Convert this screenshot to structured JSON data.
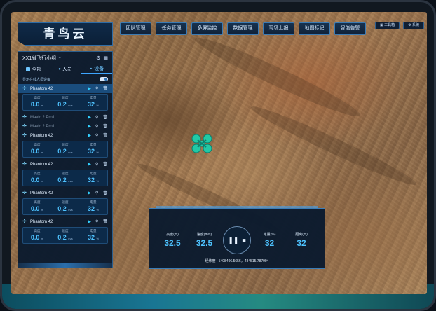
{
  "app": {
    "title": "青鸟云"
  },
  "nav": [
    "团队管理",
    "任务管理",
    "多屏监控",
    "数据管理",
    "现场上报",
    "地图标记",
    "智能告警"
  ],
  "right_buttons": [
    "工具箱",
    "系统"
  ],
  "panel": {
    "group_name": "XX1省飞行小组",
    "tabs": [
      "全部",
      "人员",
      "设备"
    ],
    "active_tab": "设备",
    "toggle_label": "显示在线人员设备",
    "devices": [
      {
        "name": "Phantom 42",
        "state": "active",
        "stats": true
      },
      {
        "name": "Mavic 2 Pro1",
        "state": "offline",
        "stats": false
      },
      {
        "name": "Mavic 2 Pro1",
        "state": "offline",
        "stats": false
      },
      {
        "name": "Phantom 42",
        "state": "online",
        "stats": true
      },
      {
        "name": "Phantom 42",
        "state": "online",
        "stats": true
      },
      {
        "name": "Phantom 42",
        "state": "online",
        "stats": true
      },
      {
        "name": "Phantom 42",
        "state": "online",
        "stats": true
      }
    ],
    "stat_labels": [
      "高度",
      "速度",
      "电量"
    ],
    "stat_values": [
      "0.0",
      "0.2",
      "32"
    ],
    "stat_units": [
      "m",
      "m/s",
      "%"
    ]
  },
  "control": {
    "height_label": "高度(m)",
    "height_value": "32.5",
    "speed_label": "速度(m/s)",
    "speed_value": "32.5",
    "battery_label": "电量(%)",
    "battery_value": "32",
    "distance_label": "距离(m)",
    "distance_value": "32",
    "coords_label": "经纬度",
    "coords_value": "5498496.5656，484515.787994"
  },
  "colors": {
    "accent": "#4ec3ff",
    "panel_bg": "#0a1a2e",
    "drone": "#21c9a6"
  }
}
